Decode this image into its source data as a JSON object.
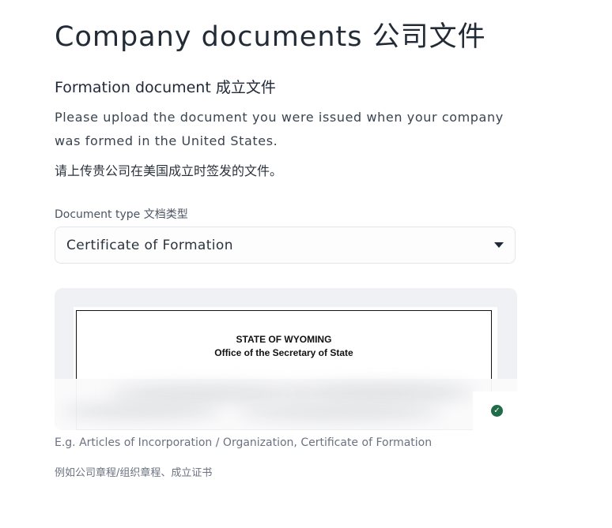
{
  "page": {
    "title": "Company documents 公司文件"
  },
  "section": {
    "title": "Formation document 成立文件",
    "description": "Please upload the document you were issued when your company was formed in the United States.",
    "description_cn": "请上传贵公司在美国成立时签发的文件。"
  },
  "document_type": {
    "label": "Document type 文档类型",
    "selected": "Certificate of Formation"
  },
  "preview": {
    "heading_line1": "STATE OF WYOMING",
    "heading_line2": "Office of the Secretary of State",
    "status_icon": "check-circle-icon",
    "status_color": "#1f6b4a"
  },
  "hints": {
    "examples": "E.g. Articles of Incorporation / Organization, Certificate of Formation",
    "examples_cn": "例如公司章程/组织章程、成立证书"
  }
}
